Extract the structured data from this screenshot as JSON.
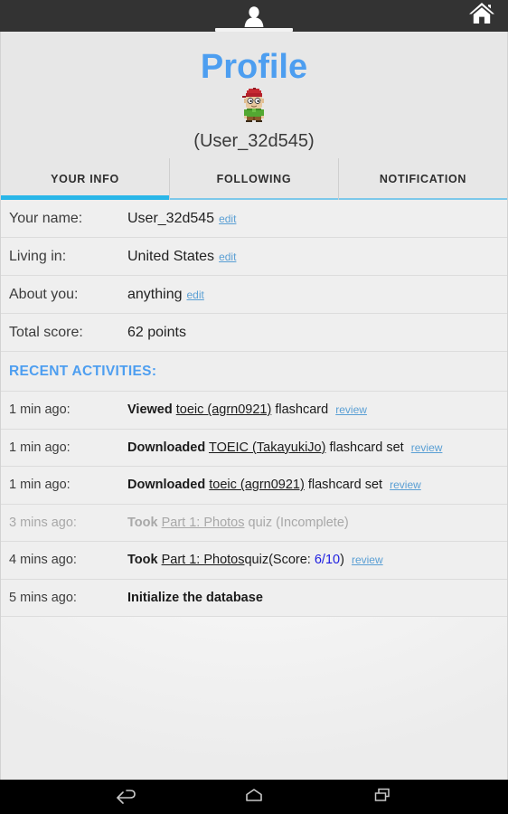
{
  "actionbar": {
    "profile_tab_icon": "person-icon",
    "home_icon": "home-icon"
  },
  "header": {
    "title": "Profile",
    "avatar_icon": "avatar-character-icon",
    "username": "(User_32d545)"
  },
  "tabs": [
    {
      "label": "YOUR INFO",
      "active": true
    },
    {
      "label": "FOLLOWING",
      "active": false
    },
    {
      "label": "NOTIFICATION",
      "active": false
    }
  ],
  "info": {
    "rows": [
      {
        "label": "Your name:",
        "value": "User_32d545",
        "edit": "edit"
      },
      {
        "label": "Living in:",
        "value": "United States",
        "edit": "edit"
      },
      {
        "label": "About you:",
        "value": "anything",
        "edit": "edit"
      },
      {
        "label": "Total score:",
        "value": "62 points",
        "edit": ""
      }
    ]
  },
  "activities": {
    "heading": "RECENT ACTIVITIES:",
    "rows": [
      {
        "time": "1 min ago:",
        "verb": "Viewed",
        "item": "toeic (agrn0921)",
        "suffix": "flashcard",
        "review": "review",
        "score": "",
        "dim": false
      },
      {
        "time": "1 min ago:",
        "verb": "Downloaded",
        "item": "TOEIC (TakayukiJo)",
        "suffix": "flashcard set",
        "review": "review",
        "score": "",
        "dim": false
      },
      {
        "time": "1 min ago:",
        "verb": "Downloaded",
        "item": "toeic (agrn0921)",
        "suffix": "flashcard set",
        "review": "review",
        "score": "",
        "dim": false
      },
      {
        "time": "3 mins ago:",
        "verb": "Took",
        "item": "Part 1: Photos",
        "suffix": "quiz (Incomplete)",
        "review": "",
        "score": "",
        "dim": true
      },
      {
        "time": "4 mins ago:",
        "verb": "Took",
        "item": "Part 1: Photos",
        "suffix_pre": "quiz(Score: ",
        "score": "6/10",
        "suffix_post": ")",
        "review": "review",
        "dim": false
      },
      {
        "time": "5 mins ago:",
        "verb": "Initialize the database",
        "item": "",
        "suffix": "",
        "review": "",
        "score": "",
        "dim": false
      }
    ]
  },
  "navbar": {
    "back_icon": "back-arrow-icon",
    "home_icon": "home-outline-icon",
    "recents_icon": "recents-icon"
  },
  "colors": {
    "accent_blue": "#4d9ef0",
    "tab_underline": "#29b6e8",
    "link_blue": "#5a9fd4",
    "score_blue": "#1c1ce0",
    "actionbar_bg": "#333333"
  }
}
